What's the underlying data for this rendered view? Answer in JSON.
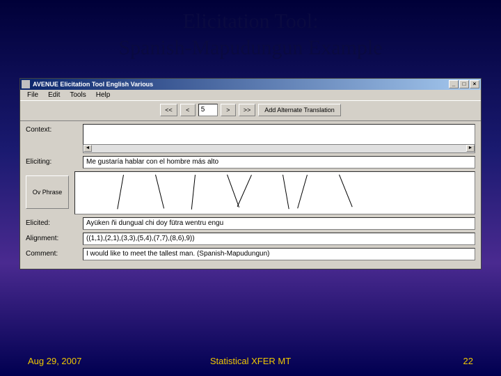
{
  "slide": {
    "title_line1": "Elicitation Tool:",
    "title_line2": "Spanish-Mapudungun Example"
  },
  "footer": {
    "date": "Aug 29, 2007",
    "center": "Statistical XFER MT",
    "page": "22"
  },
  "window": {
    "title": "AVENUE Elicitation Tool English Various",
    "menu": {
      "file": "File",
      "edit": "Edit",
      "tools": "Tools",
      "help": "Help"
    },
    "toolbar": {
      "first": "<<",
      "prev": "<",
      "page": "5",
      "next": ">",
      "last": ">>",
      "alt": "Add Alternate Translation"
    },
    "controls": {
      "min": "_",
      "max": "□",
      "close": "×"
    }
  },
  "fields": {
    "context": {
      "label": "Context:",
      "value": ""
    },
    "eliciting": {
      "label": "Eliciting:",
      "value": "Me gustaría hablar con el hombre más alto"
    },
    "ov_phrase": "Ov Phrase",
    "elicited": {
      "label": "Elicited:",
      "value": "Ayüken ñi dungual chi doy fütra wentru engu"
    },
    "alignment": {
      "label": "Alignment:",
      "value": "((1,1),(2,1),(3,3),(5,4),(7,7),(8,6),9))"
    },
    "comment": {
      "label": "Comment:",
      "value": "I would like to meet the tallest man. (Spanish-Mapudungun)"
    }
  },
  "scroll": {
    "left": "◄",
    "right": "►"
  }
}
